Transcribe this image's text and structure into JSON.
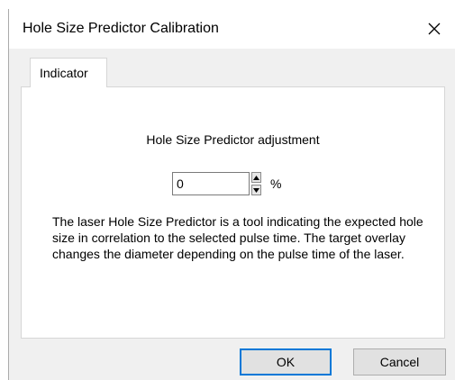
{
  "window": {
    "title": "Hole Size Predictor Calibration",
    "close_icon": "close-icon"
  },
  "tabs": [
    {
      "label": "Indicator",
      "active": true
    }
  ],
  "panel": {
    "heading": "Hole Size Predictor adjustment",
    "adjustment_value": "0",
    "unit": "%",
    "spin_up_icon": "triangle-up-icon",
    "spin_down_icon": "triangle-down-icon",
    "description": "The laser Hole Size Predictor is a tool indicating the expected hole size in correlation to the selected pulse time. The target overlay changes the diameter depending on the pulse time of the laser."
  },
  "buttons": {
    "ok": "OK",
    "cancel": "Cancel"
  },
  "colors": {
    "focus_border": "#0078d7",
    "dialog_background": "#f0f0f0"
  }
}
